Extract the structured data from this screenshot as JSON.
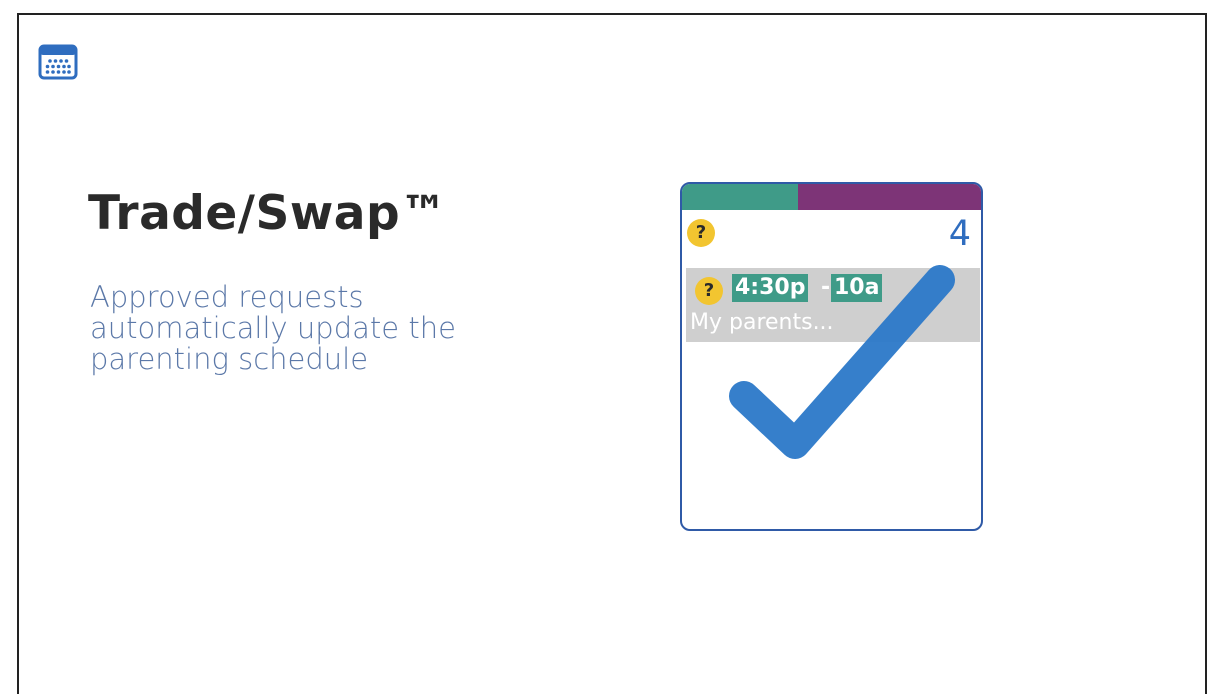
{
  "slide": {
    "title": "Trade/Swap™",
    "subtitle_lines": [
      "Approved requests",
      "automatically update the",
      "parenting schedule"
    ]
  },
  "calendar_card": {
    "day_number": "4",
    "status_badge": "?",
    "event": {
      "status_badge": "?",
      "time_start": "4:30p",
      "time_separator": "-",
      "time_end": "10a",
      "description": "My parents..."
    },
    "stripe_colors": [
      "#3f9b88",
      "#7d3477"
    ],
    "overlay_icon": "checkmark-icon"
  },
  "colors": {
    "title": "#2a2a2a",
    "subtitle": "#5b78a8",
    "card_border": "#2f5aa7",
    "badge": "#f2c530",
    "time_chip": "#3f9b88",
    "checkmark": "#2b78c8"
  },
  "app_icon": "calendar-icon"
}
